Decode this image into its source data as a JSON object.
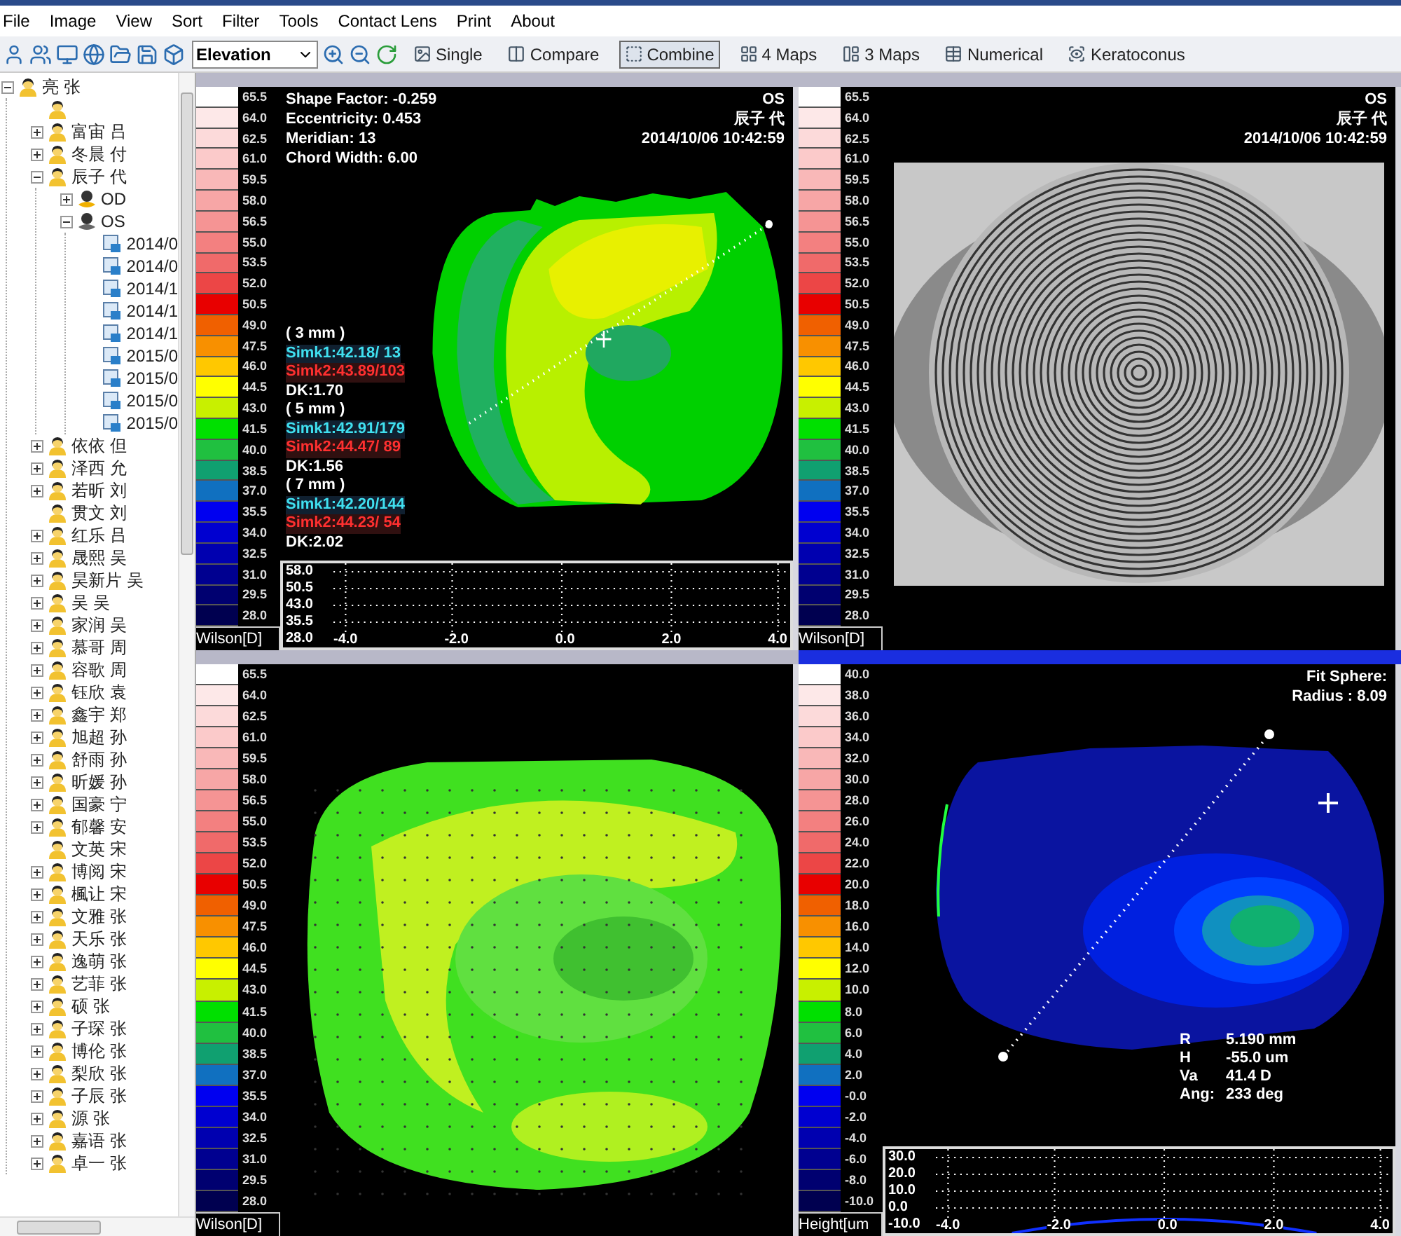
{
  "menu": [
    "File",
    "Image",
    "View",
    "Sort",
    "Filter",
    "Tools",
    "Contact Lens",
    "Print",
    "About"
  ],
  "toolbar": {
    "map_type": "Elevation",
    "views": [
      {
        "label": "Single",
        "selected": false
      },
      {
        "label": "Compare",
        "selected": false
      },
      {
        "label": "Combine",
        "selected": true
      },
      {
        "label": "4 Maps",
        "selected": false
      },
      {
        "label": "3 Maps",
        "selected": false
      },
      {
        "label": "Numerical",
        "selected": false
      },
      {
        "label": "Keratoconus",
        "selected": false
      }
    ]
  },
  "sidebar": {
    "tree": [
      {
        "kind": "patient",
        "label": "亮 张",
        "expanded": true,
        "children": [
          {
            "kind": "patient"
          },
          {
            "kind": "patient",
            "label": "富宙 吕",
            "expanded": false
          },
          {
            "kind": "patient",
            "label": "冬晨 付",
            "expanded": false
          },
          {
            "kind": "patient",
            "label": "辰子 代",
            "expanded": true,
            "children": [
              {
                "kind": "eye",
                "label": "OD",
                "expanded": false
              },
              {
                "kind": "eye",
                "label": "OS",
                "expanded": true,
                "children": [
                  {
                    "kind": "exam",
                    "label": "2014/0"
                  },
                  {
                    "kind": "exam",
                    "label": "2014/0"
                  },
                  {
                    "kind": "exam",
                    "label": "2014/1"
                  },
                  {
                    "kind": "exam",
                    "label": "2014/1"
                  },
                  {
                    "kind": "exam",
                    "label": "2014/1"
                  },
                  {
                    "kind": "exam",
                    "label": "2015/0"
                  },
                  {
                    "kind": "exam",
                    "label": "2015/0"
                  },
                  {
                    "kind": "exam",
                    "label": "2015/0"
                  },
                  {
                    "kind": "exam",
                    "label": "2015/0"
                  }
                ]
              }
            ]
          },
          {
            "kind": "patient",
            "label": "依依 但",
            "expanded": false
          },
          {
            "kind": "patient",
            "label": "泽西 允",
            "expanded": false
          },
          {
            "kind": "patient",
            "label": "若昕 刘",
            "expanded": false
          },
          {
            "kind": "patient",
            "label": "贯文 刘"
          },
          {
            "kind": "patient",
            "label": "红乐 吕",
            "expanded": false
          },
          {
            "kind": "patient",
            "label": "晟熙 吴",
            "expanded": false
          },
          {
            "kind": "patient",
            "label": "昊新片 吴",
            "expanded": false
          },
          {
            "kind": "patient",
            "label": "吴 吴",
            "expanded": false
          },
          {
            "kind": "patient",
            "label": "家润 吴",
            "expanded": false
          },
          {
            "kind": "patient",
            "label": "慕哥 周",
            "expanded": false
          },
          {
            "kind": "patient",
            "label": "容歌 周",
            "expanded": false
          },
          {
            "kind": "patient",
            "label": "钰欣 袁",
            "expanded": false
          },
          {
            "kind": "patient",
            "label": "鑫宇 郑",
            "expanded": false
          },
          {
            "kind": "patient",
            "label": "旭超 孙",
            "expanded": false
          },
          {
            "kind": "patient",
            "label": "舒雨 孙",
            "expanded": false
          },
          {
            "kind": "patient",
            "label": "昕媛 孙",
            "expanded": false
          },
          {
            "kind": "patient",
            "label": "国豪 宁",
            "expanded": false
          },
          {
            "kind": "patient",
            "label": "郁馨 安",
            "expanded": false
          },
          {
            "kind": "patient",
            "label": "文英 宋"
          },
          {
            "kind": "patient",
            "label": "博阅 宋",
            "expanded": false
          },
          {
            "kind": "patient",
            "label": "楓让 宋",
            "expanded": false
          },
          {
            "kind": "patient",
            "label": "文雅 张",
            "expanded": false
          },
          {
            "kind": "patient",
            "label": "天乐 张",
            "expanded": false
          },
          {
            "kind": "patient",
            "label": "逸萌 张",
            "expanded": false
          },
          {
            "kind": "patient",
            "label": "艺菲 张",
            "expanded": false
          },
          {
            "kind": "patient",
            "label": "硕 张",
            "expanded": false
          },
          {
            "kind": "patient",
            "label": "子琛 张",
            "expanded": false
          },
          {
            "kind": "patient",
            "label": "博伦 张",
            "expanded": false
          },
          {
            "kind": "patient",
            "label": "梨欣 张",
            "expanded": false
          },
          {
            "kind": "patient",
            "label": "子辰 张",
            "expanded": false
          },
          {
            "kind": "patient",
            "label": "源 张",
            "expanded": false
          },
          {
            "kind": "patient",
            "label": "嘉语 张",
            "expanded": false
          },
          {
            "kind": "patient",
            "label": "卓一 张",
            "expanded": false
          }
        ]
      }
    ]
  },
  "panels": [
    {
      "kind": "map",
      "selected": false,
      "scale_label": "Wilson[D]",
      "scale": [
        {
          "value": "65.5",
          "color": "#ffffff"
        },
        {
          "value": "64.0",
          "color": "#fde8e8"
        },
        {
          "value": "62.5",
          "color": "#fcdada"
        },
        {
          "value": "61.0",
          "color": "#fbcaca"
        },
        {
          "value": "59.5",
          "color": "#f9b8b8"
        },
        {
          "value": "58.0",
          "color": "#f7a6a6"
        },
        {
          "value": "56.5",
          "color": "#f59494"
        },
        {
          "value": "55.0",
          "color": "#f38080"
        },
        {
          "value": "53.5",
          "color": "#f06a6a"
        },
        {
          "value": "52.0",
          "color": "#ec4646"
        },
        {
          "value": "50.5",
          "color": "#e80000"
        },
        {
          "value": "49.0",
          "color": "#f06000"
        },
        {
          "value": "47.5",
          "color": "#f89000"
        },
        {
          "value": "46.0",
          "color": "#ffc800"
        },
        {
          "value": "44.5",
          "color": "#ffff00"
        },
        {
          "value": "43.0",
          "color": "#c8f000"
        },
        {
          "value": "41.5",
          "color": "#00e000"
        },
        {
          "value": "40.0",
          "color": "#20c040"
        },
        {
          "value": "38.5",
          "color": "#10a070"
        },
        {
          "value": "37.0",
          "color": "#1070c0"
        },
        {
          "value": "35.5",
          "color": "#0000f0"
        },
        {
          "value": "34.0",
          "color": "#0000d0"
        },
        {
          "value": "32.5",
          "color": "#0000b0"
        },
        {
          "value": "31.0",
          "color": "#000090"
        },
        {
          "value": "29.5",
          "color": "#000070"
        },
        {
          "value": "28.0",
          "color": "#000050"
        }
      ],
      "info": [
        "Shape Factor: -0.259",
        "Eccentricity: 0.453",
        "Meridian: 13",
        "Chord Width: 6.00"
      ],
      "header": [
        "OS",
        "辰子 代",
        "2014/10/06 10:42:59"
      ],
      "simk": [
        {
          "kind": "zone",
          "text": "( 3 mm )"
        },
        {
          "kind": "simk1",
          "text": "Simk1:42.18/ 13"
        },
        {
          "kind": "simk2",
          "text": "Simk2:43.89/103"
        },
        {
          "kind": "dk",
          "text": "DK:1.70"
        },
        {
          "kind": "zone",
          "text": "( 5 mm )"
        },
        {
          "kind": "simk1",
          "text": "Simk1:42.91/179"
        },
        {
          "kind": "simk2",
          "text": "Simk2:44.47/ 89"
        },
        {
          "kind": "dk",
          "text": "DK:1.56"
        },
        {
          "kind": "zone",
          "text": "( 7 mm )"
        },
        {
          "kind": "simk1",
          "text": "Simk1:42.20/144"
        },
        {
          "kind": "simk2",
          "text": "Simk2:44.23/ 54"
        },
        {
          "kind": "dk",
          "text": "DK:2.02"
        }
      ],
      "profile": {
        "y_labels": [
          "58.0",
          "50.5",
          "43.0",
          "35.5",
          "28.0"
        ],
        "x_labels": [
          "-4.0",
          "-2.0",
          "0.0",
          "2.0",
          "4.0"
        ]
      }
    },
    {
      "kind": "photo",
      "selected": false,
      "scale_label": "Wilson[D]",
      "scale": [
        {
          "value": "65.5",
          "color": "#ffffff"
        },
        {
          "value": "64.0",
          "color": "#fde8e8"
        },
        {
          "value": "62.5",
          "color": "#fcdada"
        },
        {
          "value": "61.0",
          "color": "#fbcaca"
        },
        {
          "value": "59.5",
          "color": "#f9b8b8"
        },
        {
          "value": "58.0",
          "color": "#f7a6a6"
        },
        {
          "value": "56.5",
          "color": "#f59494"
        },
        {
          "value": "55.0",
          "color": "#f38080"
        },
        {
          "value": "53.5",
          "color": "#f06a6a"
        },
        {
          "value": "52.0",
          "color": "#ec4646"
        },
        {
          "value": "50.5",
          "color": "#e80000"
        },
        {
          "value": "49.0",
          "color": "#f06000"
        },
        {
          "value": "47.5",
          "color": "#f89000"
        },
        {
          "value": "46.0",
          "color": "#ffc800"
        },
        {
          "value": "44.5",
          "color": "#ffff00"
        },
        {
          "value": "43.0",
          "color": "#c8f000"
        },
        {
          "value": "41.5",
          "color": "#00e000"
        },
        {
          "value": "40.0",
          "color": "#20c040"
        },
        {
          "value": "38.5",
          "color": "#10a070"
        },
        {
          "value": "37.0",
          "color": "#1070c0"
        },
        {
          "value": "35.5",
          "color": "#0000f0"
        },
        {
          "value": "34.0",
          "color": "#0000d0"
        },
        {
          "value": "32.5",
          "color": "#0000b0"
        },
        {
          "value": "31.0",
          "color": "#000090"
        },
        {
          "value": "29.5",
          "color": "#000070"
        },
        {
          "value": "28.0",
          "color": "#000050"
        }
      ],
      "header": [
        "OS",
        "辰子 代",
        "2014/10/06 10:42:59"
      ]
    },
    {
      "kind": "dots",
      "selected": false,
      "scale_label": "Wilson[D]",
      "scale": [
        {
          "value": "65.5",
          "color": "#ffffff"
        },
        {
          "value": "64.0",
          "color": "#fde8e8"
        },
        {
          "value": "62.5",
          "color": "#fcdada"
        },
        {
          "value": "61.0",
          "color": "#fbcaca"
        },
        {
          "value": "59.5",
          "color": "#f9b8b8"
        },
        {
          "value": "58.0",
          "color": "#f7a6a6"
        },
        {
          "value": "56.5",
          "color": "#f59494"
        },
        {
          "value": "55.0",
          "color": "#f38080"
        },
        {
          "value": "53.5",
          "color": "#f06a6a"
        },
        {
          "value": "52.0",
          "color": "#ec4646"
        },
        {
          "value": "50.5",
          "color": "#e80000"
        },
        {
          "value": "49.0",
          "color": "#f06000"
        },
        {
          "value": "47.5",
          "color": "#f89000"
        },
        {
          "value": "46.0",
          "color": "#ffc800"
        },
        {
          "value": "44.5",
          "color": "#ffff00"
        },
        {
          "value": "43.0",
          "color": "#c8f000"
        },
        {
          "value": "41.5",
          "color": "#00e000"
        },
        {
          "value": "40.0",
          "color": "#20c040"
        },
        {
          "value": "38.5",
          "color": "#10a070"
        },
        {
          "value": "37.0",
          "color": "#1070c0"
        },
        {
          "value": "35.5",
          "color": "#0000f0"
        },
        {
          "value": "34.0",
          "color": "#0000d0"
        },
        {
          "value": "32.5",
          "color": "#0000b0"
        },
        {
          "value": "31.0",
          "color": "#000090"
        },
        {
          "value": "29.5",
          "color": "#000070"
        },
        {
          "value": "28.0",
          "color": "#000050"
        }
      ]
    },
    {
      "kind": "height",
      "selected": true,
      "scale_label": "Height[um",
      "scale": [
        {
          "value": "40.0",
          "color": "#ffffff"
        },
        {
          "value": "38.0",
          "color": "#fde8e8"
        },
        {
          "value": "36.0",
          "color": "#fcdada"
        },
        {
          "value": "34.0",
          "color": "#fbcaca"
        },
        {
          "value": "32.0",
          "color": "#f9b8b8"
        },
        {
          "value": "30.0",
          "color": "#f7a6a6"
        },
        {
          "value": "28.0",
          "color": "#f59494"
        },
        {
          "value": "26.0",
          "color": "#f38080"
        },
        {
          "value": "24.0",
          "color": "#f06a6a"
        },
        {
          "value": "22.0",
          "color": "#ec4646"
        },
        {
          "value": "20.0",
          "color": "#e80000"
        },
        {
          "value": "18.0",
          "color": "#f06000"
        },
        {
          "value": "16.0",
          "color": "#f89000"
        },
        {
          "value": "14.0",
          "color": "#ffc800"
        },
        {
          "value": "12.0",
          "color": "#ffff00"
        },
        {
          "value": "10.0",
          "color": "#c8f000"
        },
        {
          "value": "8.0",
          "color": "#00e000"
        },
        {
          "value": "6.0",
          "color": "#20c040"
        },
        {
          "value": "4.0",
          "color": "#10a070"
        },
        {
          "value": "2.0",
          "color": "#1070c0"
        },
        {
          "value": "-0.0",
          "color": "#0000f0"
        },
        {
          "value": "-2.0",
          "color": "#0000d0"
        },
        {
          "value": "-4.0",
          "color": "#0000b0"
        },
        {
          "value": "-6.0",
          "color": "#000090"
        },
        {
          "value": "-8.0",
          "color": "#000070"
        },
        {
          "value": "-10.0",
          "color": "#000050"
        }
      ],
      "header": [
        "Fit Sphere:",
        "Radius : 8.09"
      ],
      "readings": [
        {
          "label": "R",
          "value": "5.190 mm"
        },
        {
          "label": "H",
          "value": "-55.0 um"
        },
        {
          "label": "Va",
          "value": "41.4 D"
        },
        {
          "label": "Ang:",
          "value": "233 deg"
        }
      ],
      "profile": {
        "y_labels": [
          "30.0",
          "20.0",
          "10.0",
          "0.0",
          "-10.0"
        ],
        "x_labels": [
          "-4.0",
          "-2.0",
          "0.0",
          "2.0",
          "4.0"
        ]
      }
    }
  ]
}
